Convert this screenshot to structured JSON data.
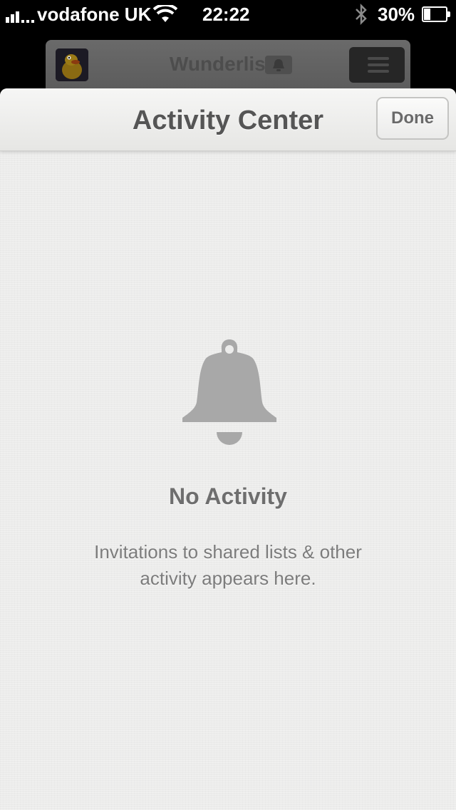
{
  "status_bar": {
    "carrier": "vodafone UK",
    "time": "22:22",
    "battery_percent": "30%",
    "battery_level": 0.3,
    "signal_bars": 3,
    "icons": [
      "signal-icon",
      "wifi-icon",
      "bluetooth-icon",
      "battery-icon"
    ]
  },
  "background_app": {
    "title": "Wunderlist",
    "icons": [
      "avatar",
      "bell-icon",
      "menu-icon"
    ]
  },
  "nav_bar": {
    "title": "Activity Center",
    "done_label": "Done"
  },
  "empty_state": {
    "icon": "bell-icon",
    "title": "No Activity",
    "description": "Invitations to shared lists & other activity appears here."
  },
  "colors": {
    "sheet_background": "#ececeb",
    "title_text": "#555555",
    "icon_gray": "#a8a8a8"
  }
}
